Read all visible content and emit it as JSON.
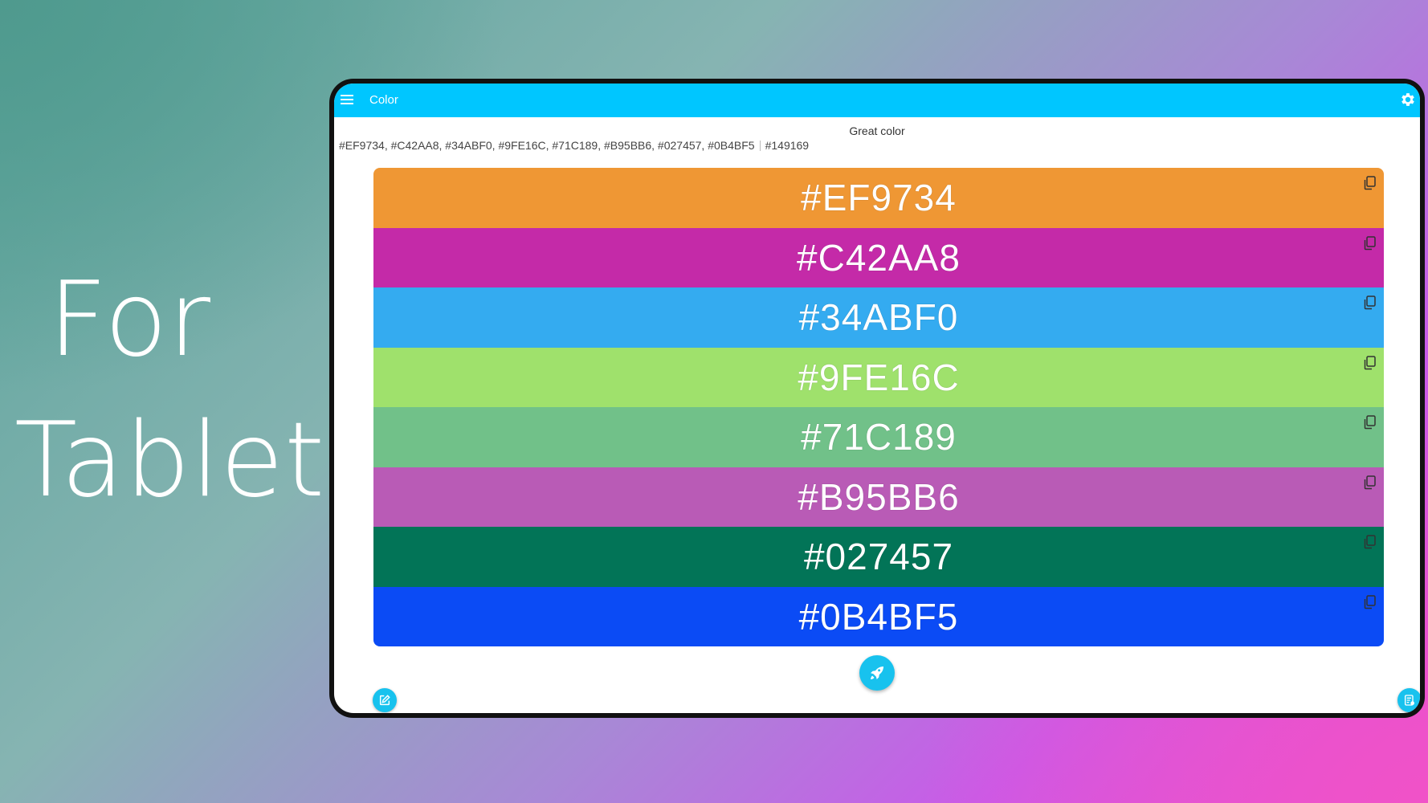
{
  "promo": {
    "line1": "For",
    "line2": "Tablets"
  },
  "appbar": {
    "title": "Color",
    "menu_icon": "menu-icon",
    "settings_icon": "gear-icon",
    "color": "#00c6ff"
  },
  "header": {
    "subtitle": "Great color",
    "palette_list": "#EF9734, #C42AA8, #34ABF0, #9FE16C, #71C189, #B95BB6, #027457, #0B4BF5",
    "extra_code": "#149169"
  },
  "swatches": [
    {
      "label": "#EF9734",
      "color": "#EF9734"
    },
    {
      "label": "#C42AA8",
      "color": "#C42AA8"
    },
    {
      "label": "#34ABF0",
      "color": "#34ABF0"
    },
    {
      "label": "#9FE16C",
      "color": "#9FE16C"
    },
    {
      "label": "#71C189",
      "color": "#71C189"
    },
    {
      "label": "#B95BB6",
      "color": "#B95BB6"
    },
    {
      "label": "#027457",
      "color": "#027457"
    },
    {
      "label": "#0B4BF5",
      "color": "#0B4BF5"
    }
  ],
  "actions": {
    "generate_icon": "rocket-icon",
    "edit_icon": "edit-icon",
    "saved_icon": "saved-list-icon",
    "fab_color": "#18c2ee"
  }
}
